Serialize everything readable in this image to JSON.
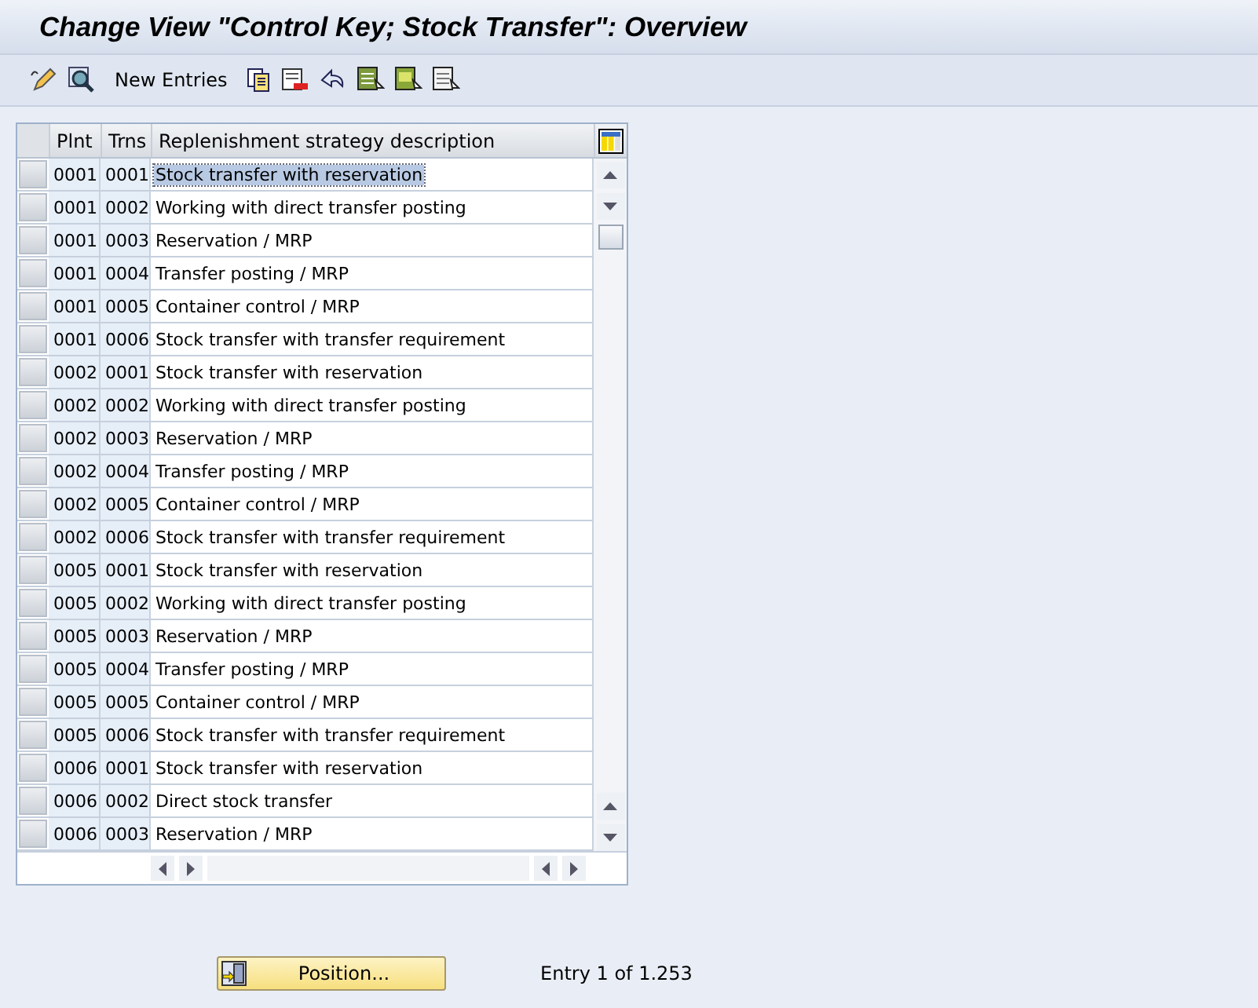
{
  "window": {
    "title": "Change View \"Control Key; Stock Transfer\": Overview"
  },
  "toolbar": {
    "new_entries": "New Entries"
  },
  "table": {
    "columns": [
      "Plnt",
      "Trns",
      "Replenishment strategy description"
    ],
    "rows": [
      {
        "plnt": "0001",
        "trns": "0001",
        "description": "Stock transfer with reservation",
        "selected": true
      },
      {
        "plnt": "0001",
        "trns": "0002",
        "description": "Working with direct transfer posting",
        "selected": false
      },
      {
        "plnt": "0001",
        "trns": "0003",
        "description": "Reservation / MRP",
        "selected": false
      },
      {
        "plnt": "0001",
        "trns": "0004",
        "description": "Transfer posting / MRP",
        "selected": false
      },
      {
        "plnt": "0001",
        "trns": "0005",
        "description": "Container control / MRP",
        "selected": false
      },
      {
        "plnt": "0001",
        "trns": "0006",
        "description": "Stock transfer with transfer requirement",
        "selected": false
      },
      {
        "plnt": "0002",
        "trns": "0001",
        "description": "Stock transfer with reservation",
        "selected": false
      },
      {
        "plnt": "0002",
        "trns": "0002",
        "description": "Working with direct transfer posting",
        "selected": false
      },
      {
        "plnt": "0002",
        "trns": "0003",
        "description": "Reservation / MRP",
        "selected": false
      },
      {
        "plnt": "0002",
        "trns": "0004",
        "description": "Transfer posting / MRP",
        "selected": false
      },
      {
        "plnt": "0002",
        "trns": "0005",
        "description": "Container control / MRP",
        "selected": false
      },
      {
        "plnt": "0002",
        "trns": "0006",
        "description": "Stock transfer with transfer requirement",
        "selected": false
      },
      {
        "plnt": "0005",
        "trns": "0001",
        "description": "Stock transfer with reservation",
        "selected": false
      },
      {
        "plnt": "0005",
        "trns": "0002",
        "description": "Working with direct transfer posting",
        "selected": false
      },
      {
        "plnt": "0005",
        "trns": "0003",
        "description": "Reservation / MRP",
        "selected": false
      },
      {
        "plnt": "0005",
        "trns": "0004",
        "description": "Transfer posting / MRP",
        "selected": false
      },
      {
        "plnt": "0005",
        "trns": "0005",
        "description": "Container control / MRP",
        "selected": false
      },
      {
        "plnt": "0005",
        "trns": "0006",
        "description": "Stock transfer with transfer requirement",
        "selected": false
      },
      {
        "plnt": "0006",
        "trns": "0001",
        "description": "Stock transfer with reservation",
        "selected": false
      },
      {
        "plnt": "0006",
        "trns": "0002",
        "description": "Direct stock transfer",
        "selected": false
      },
      {
        "plnt": "0006",
        "trns": "0003",
        "description": "Reservation / MRP",
        "selected": false
      }
    ]
  },
  "position_button": "Position...",
  "entry_info": "Entry 1 of 1.253"
}
